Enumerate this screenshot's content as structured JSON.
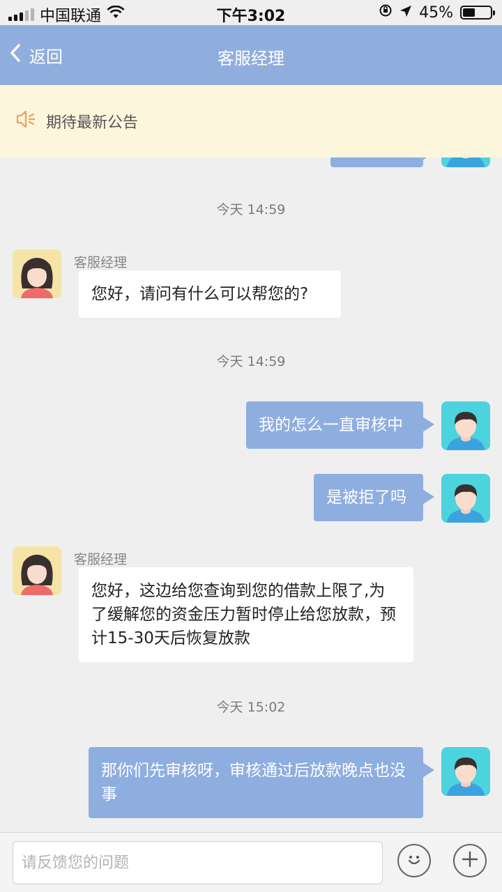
{
  "status_bar": {
    "carrier": "中国联通",
    "time": "下午3:02",
    "battery": "45%",
    "battery_level": 0.45
  },
  "nav": {
    "back_label": "返回",
    "title": "客服经理"
  },
  "announcement": {
    "text": "期待最新公告"
  },
  "messages": {
    "times": [
      "今天 14:59",
      "今天 14:59",
      "今天 15:02"
    ],
    "sender_name": "客服经理",
    "items": [
      {
        "side": "left",
        "text": "您好，请问有什么可以帮您的?"
      },
      {
        "side": "right",
        "text": "我的怎么一直审核中"
      },
      {
        "side": "right",
        "text": "是被拒了吗"
      },
      {
        "side": "left",
        "text": "您好，这边给您查询到您的借款上限了,为了缓解您的资金压力暂时停止给您放款，预计15-30天后恢复放款"
      },
      {
        "side": "right",
        "text": "那你们先审核呀，审核通过后放款晚点也没事"
      }
    ]
  },
  "input_bar": {
    "placeholder": "请反馈您的问题",
    "value": ""
  },
  "colors": {
    "nav": "#90aedd",
    "bubble_self": "#8eaee0",
    "notice_bg": "#fcf6dd",
    "notice_icon": "#f0a05a"
  }
}
